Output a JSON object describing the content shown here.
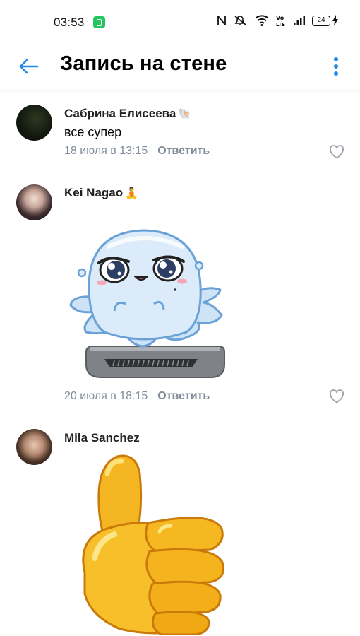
{
  "status_bar": {
    "time": "03:53",
    "battery": "24",
    "icons": [
      "nfc-icon",
      "mute-icon",
      "wifi-icon",
      "volte-icon",
      "signal-icon",
      "battery-icon",
      "charging-icon"
    ]
  },
  "header": {
    "title": "Запись на стене",
    "accent_color": "#2688eb"
  },
  "comments": [
    {
      "author": "Сабрина Елисеева",
      "author_emoji": "🐚",
      "text": "все супер",
      "date": "18 июля в 13:15",
      "reply_label": "Ответить"
    },
    {
      "author": "Kei Nagao",
      "author_emoji": "🧘",
      "sticker": "ghost-octopus-sticker",
      "date": "20 июля в 18:15",
      "reply_label": "Ответить"
    },
    {
      "author": "Mila Sanchez",
      "sticker": "thumbs-up-sticker"
    }
  ]
}
